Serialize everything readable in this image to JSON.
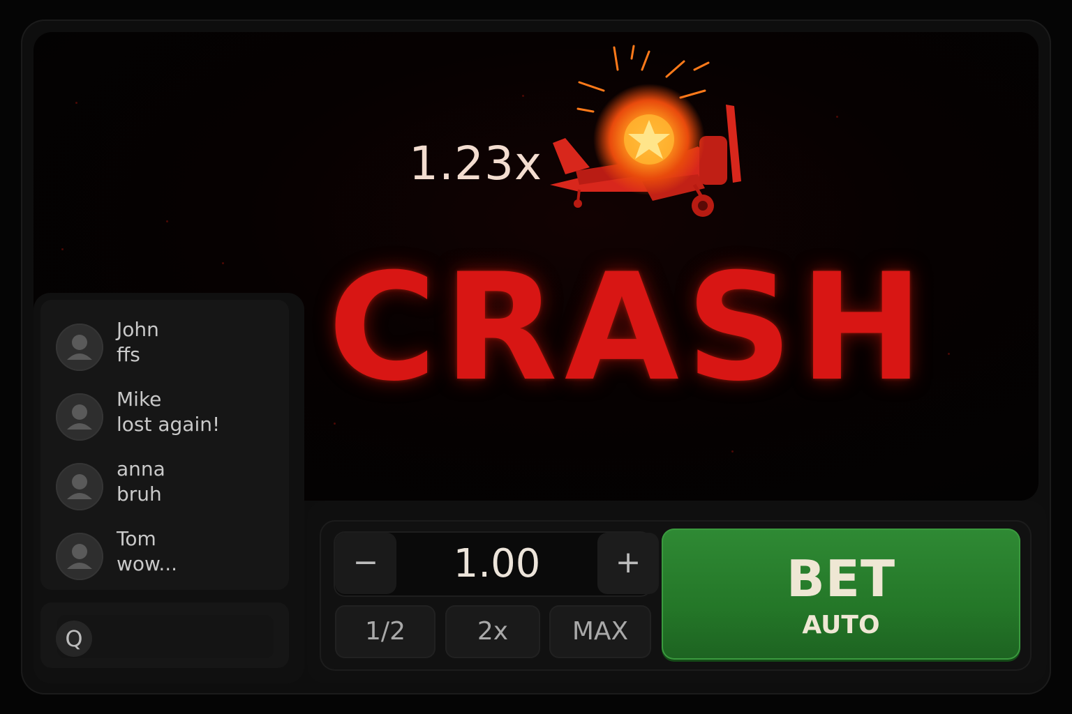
{
  "game": {
    "multiplier": "1.23x",
    "status": "CRASH",
    "status_color": "#d81614"
  },
  "chat": {
    "messages": [
      {
        "user": "John",
        "text": "ffs",
        "avatar_icon": "user-avatar-icon"
      },
      {
        "user": "Mike",
        "text": "lost again!",
        "avatar_icon": "user-avatar-icon"
      },
      {
        "user": "anna",
        "text": "bruh",
        "avatar_icon": "user-avatar-icon"
      },
      {
        "user": "Tom",
        "text": "wow...",
        "avatar_icon": "user-avatar-icon"
      }
    ],
    "input_icon": "Q"
  },
  "bet": {
    "minus_label": "−",
    "plus_label": "+",
    "amount": "1.00",
    "half_label": "1/2",
    "double_label": "2x",
    "max_label": "MAX",
    "bet_label": "BET",
    "auto_label": "AUTO",
    "bet_button_color": "#247728"
  }
}
